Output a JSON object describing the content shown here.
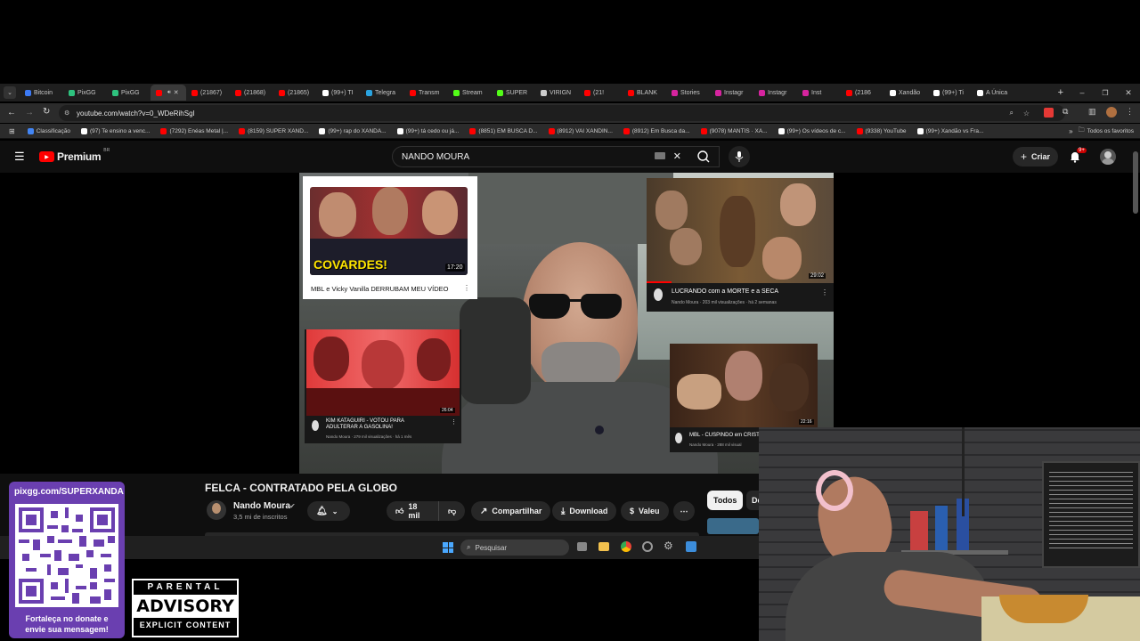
{
  "browser": {
    "tabs": [
      {
        "label": "Bitcoin",
        "color": "#3c7af5"
      },
      {
        "label": "PixGG",
        "color": "#2ec27e"
      },
      {
        "label": "PixGG",
        "color": "#2ec27e"
      },
      {
        "label": "",
        "color": "#ff0000",
        "active": true
      },
      {
        "label": "(21867)",
        "color": "#ff0000"
      },
      {
        "label": "(21868)",
        "color": "#ff0000"
      },
      {
        "label": "(21865)",
        "color": "#ff0000"
      },
      {
        "label": "(99+) TI",
        "color": "#ffffff"
      },
      {
        "label": "Telegra",
        "color": "#2aa3e0"
      },
      {
        "label": "Transm",
        "color": "#ff0000"
      },
      {
        "label": "Stream",
        "color": "#53fc18"
      },
      {
        "label": "SUPER",
        "color": "#53fc18"
      },
      {
        "label": "VIRIGN",
        "color": "#cccccc"
      },
      {
        "label": "(21!",
        "color": "#ff0000"
      },
      {
        "label": "BLANK",
        "color": "#ff0000"
      },
      {
        "label": "Stories",
        "color": "#d6249f"
      },
      {
        "label": "Instagr",
        "color": "#d6249f"
      },
      {
        "label": "Instagr",
        "color": "#d6249f"
      },
      {
        "label": "Inst",
        "color": "#d6249f"
      },
      {
        "label": "(2186",
        "color": "#ff0000"
      },
      {
        "label": "Xandão",
        "color": "#ffffff"
      },
      {
        "label": "(99+) Ti",
        "color": "#ffffff"
      },
      {
        "label": "A Única",
        "color": "#ffffff"
      }
    ],
    "new_tab": "+",
    "url": "youtube.com/watch?v=0_WDeRihSgI",
    "bookmarks": [
      {
        "label": "Classificação",
        "color": "#4285f4"
      },
      {
        "label": "(97) Te ensino a venc...",
        "color": "#ffffff"
      },
      {
        "label": "(7292) Enéas Metal |...",
        "color": "#ff0000"
      },
      {
        "label": "(8159) SUPER XAND...",
        "color": "#ff0000"
      },
      {
        "label": "(99+) rap do XANDÃ...",
        "color": "#ffffff"
      },
      {
        "label": "(99+) tá cedo ou já...",
        "color": "#ffffff"
      },
      {
        "label": "(8851) EM BUSCA D...",
        "color": "#ff0000"
      },
      {
        "label": "(8912) VAI XANDIN...",
        "color": "#ff0000"
      },
      {
        "label": "(8912) Em Busca da...",
        "color": "#ff0000"
      },
      {
        "label": "(9078) MANTIS · XA...",
        "color": "#ff0000"
      },
      {
        "label": "(99+) Os vídeos de c...",
        "color": "#ffffff"
      },
      {
        "label": "(9338) YouTube",
        "color": "#ff0000"
      },
      {
        "label": "(99+) Xandão vs Fra...",
        "color": "#ffffff"
      }
    ],
    "all_favorites": "Todos os favoritos"
  },
  "youtube": {
    "logo_text": "Premium",
    "logo_region": "BR",
    "search_value": "NANDO MOURA",
    "create_label": "Criar",
    "notif_count": "9+",
    "video_title": "FELCA - CONTRATADO PELA GLOBO",
    "channel_name": "Nando Moura",
    "subscribers": "3,5 mi de inscritos",
    "likes": "18 mil",
    "share_label": "Compartilhar",
    "download_label": "Download",
    "thanks_label": "Valeu",
    "chips": [
      "Todos",
      "De"
    ],
    "endcards": [
      {
        "title": "MBL e Vicky Vanilla DERRUBAM MEU VÍDEO",
        "badge": "COVARDES!",
        "duration": "17:20"
      },
      {
        "title": "LUCRANDO com a MORTE e a SECA",
        "meta": "Nando Moura · 203 mil visualizações · há 2 semanas",
        "duration": "29:02"
      },
      {
        "title": "KIM KATAGUIRI - VOTOU PARA ADULTERAR A GASOLINA!",
        "meta": "Nando Moura · 279 mil visualizações · há 1 mês",
        "duration": "26:04"
      },
      {
        "title": "MBL - CUSPINDO em CRIST",
        "meta": "Nando Moura · 288 mil visual",
        "duration": "22:16"
      }
    ]
  },
  "taskbar": {
    "search_placeholder": "Pesquisar"
  },
  "donate": {
    "url": "pixgg.com/SUPERXANDA",
    "message": "Fortaleça no donate e envie sua mensagem!"
  },
  "advisory": {
    "line1": "PARENTAL",
    "line2": "ADVISORY",
    "line3": "EXPLICIT CONTENT"
  }
}
